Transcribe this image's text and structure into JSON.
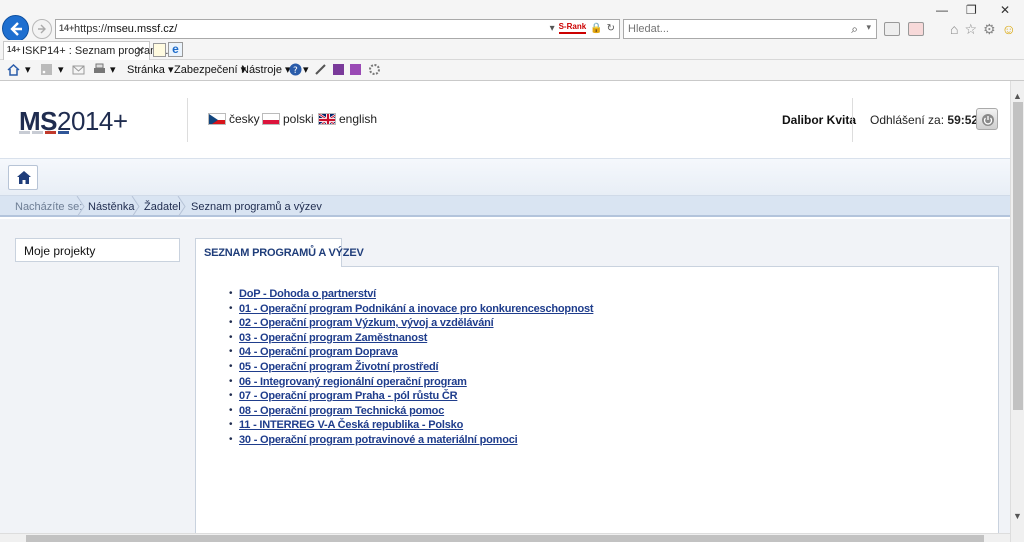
{
  "browser": {
    "url_prefix": "https://",
    "url_domain": "mseu.mssf.cz/",
    "srank_label": "S-Rank",
    "search_placeholder": "Hledat...",
    "tab_title": "ISKP14+ : Seznam program...",
    "tab_icon_text": "14+",
    "menu": {
      "page": "Stránka ▾",
      "security": "Zabezpečení ▾",
      "tools": "Nástroje ▾"
    }
  },
  "header": {
    "logo_bold": "MS",
    "logo_light": "2014+",
    "logo_colors": [
      "#c8ccd4",
      "#c8ccd4",
      "#c0392b",
      "#2f5597"
    ],
    "languages": [
      {
        "label": "česky",
        "flag": "cz-flag-icon"
      },
      {
        "label": "polski",
        "flag": "pl-flag-icon"
      },
      {
        "label": "english",
        "flag": "gb-flag-icon"
      }
    ],
    "user_name": "Dalibor Kvita",
    "logout_label": "Odhlášení za:",
    "logout_time": "59:52"
  },
  "breadcrumb": {
    "label": "Nacházíte se:",
    "items": [
      "Nástěnka",
      "Žadatel",
      "Seznam programů a výzev"
    ]
  },
  "sidebar": {
    "items": [
      {
        "label": "Moje projekty"
      }
    ]
  },
  "panel": {
    "tab_label": "SEZNAM PROGRAMŮ A VÝZEV",
    "programs": [
      "DoP - Dohoda o partnerství",
      "01 - Operační program Podnikání a inovace pro konkurenceschopnost",
      "02 - Operační program Výzkum, vývoj a vzdělávání",
      "03 - Operační program Zaměstnanost",
      "04 - Operační program Doprava",
      "05 - Operační program Životní prostředí",
      "06 - Integrovaný regionální operační program",
      "07 - Operační program Praha - pól růstu ČR",
      "08 - Operační program Technická pomoc",
      "11 - INTERREG V-A Česká republika - Polsko",
      "30 - Operační program potravinové a materiální pomoci"
    ]
  },
  "colors": {
    "accent": "#1f3d8c",
    "browser_back": "#1e6fd0"
  }
}
